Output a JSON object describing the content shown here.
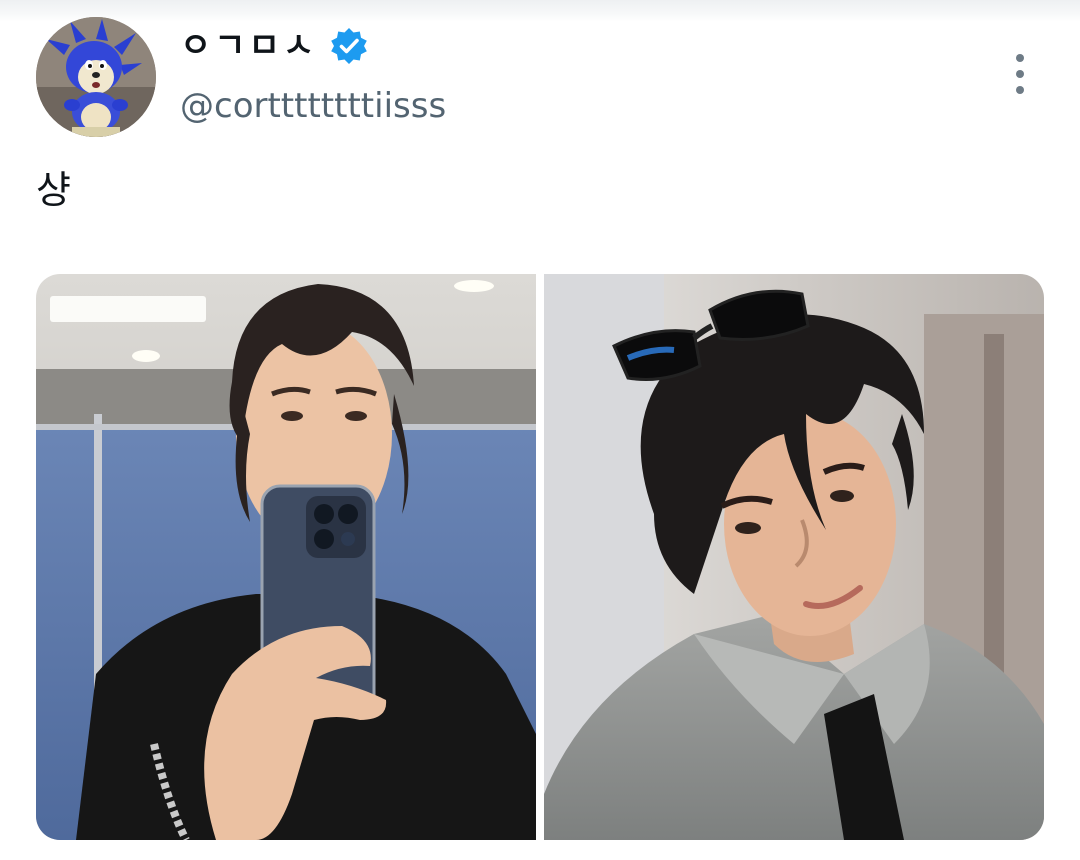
{
  "tweet": {
    "author": {
      "display_name": "ㅇㄱㅁㅅ",
      "handle": "@corttttttttiisss",
      "verified": true,
      "avatar_icon": "blue-hedgehog-avatar"
    },
    "text": "샹",
    "media": [
      {
        "icon": "mirror-selfie-photo"
      },
      {
        "icon": "portrait-with-sunglasses-photo"
      }
    ],
    "more_icon": "more-vertical-icon"
  },
  "colors": {
    "text_primary": "#0f1419",
    "text_secondary": "#536471",
    "verified_blue": "#1d9bf0",
    "background": "#ffffff"
  }
}
